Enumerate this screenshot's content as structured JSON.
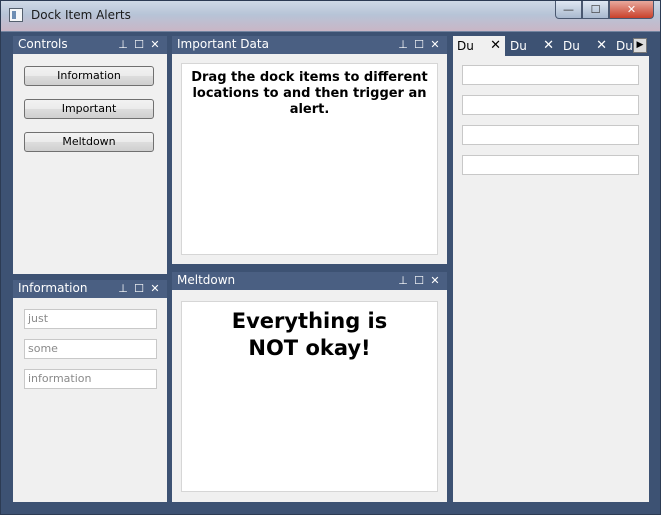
{
  "window": {
    "title": "Dock Item Alerts"
  },
  "caption": {
    "minimize": "—",
    "maximize": "☐",
    "close": "✕"
  },
  "controls": {
    "title": "Controls",
    "buttons": [
      "Information",
      "Important",
      "Meltdown"
    ]
  },
  "information": {
    "title": "Information",
    "fields": [
      "just",
      "some",
      "information"
    ]
  },
  "important": {
    "title": "Important Data",
    "text": "Drag the dock items to different locations to and then trigger an alert."
  },
  "meltdown": {
    "title": "Meltdown",
    "text": "Everything is NOT okay!"
  },
  "tabs": {
    "items": [
      "Du",
      "Du",
      "Du",
      "Du"
    ],
    "active_index": 0
  },
  "dock_buttons": {
    "pin": "⊥",
    "float": "☐",
    "close": "✕"
  }
}
